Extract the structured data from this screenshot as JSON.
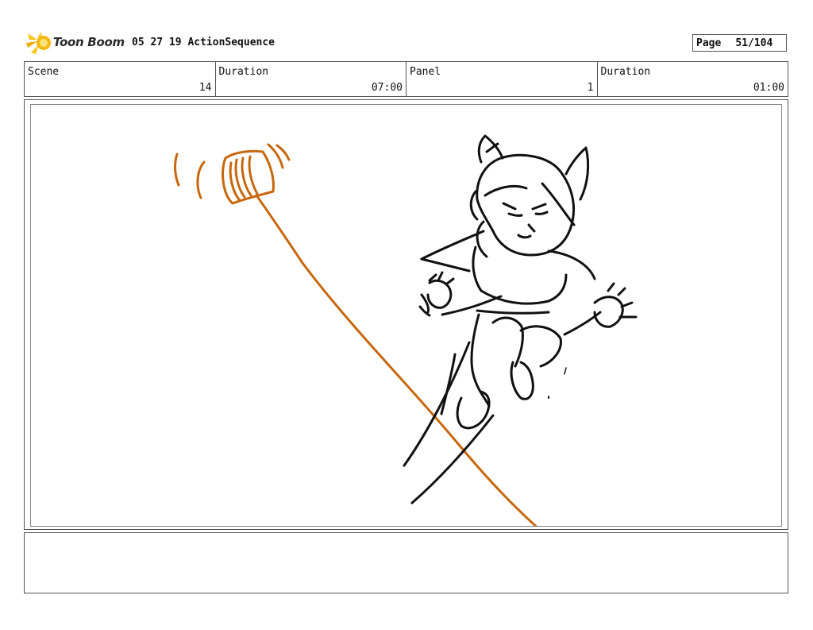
{
  "header": {
    "logo_text": "Toon Boom",
    "project_title": "05 27 19 ActionSequence",
    "page_label": "Page",
    "page_number": "51/104"
  },
  "info": {
    "scene_label": "Scene",
    "scene_value": "14",
    "scene_duration_label": "Duration",
    "scene_duration_value": "07:00",
    "panel_label": "Panel",
    "panel_value": "1",
    "panel_duration_label": "Duration",
    "panel_duration_value": "01:00"
  },
  "colors": {
    "sketch_ink": "#111111",
    "sketch_accent": "#c8670d",
    "logo_star": "#f2b90f"
  },
  "notes": {
    "text": ""
  }
}
